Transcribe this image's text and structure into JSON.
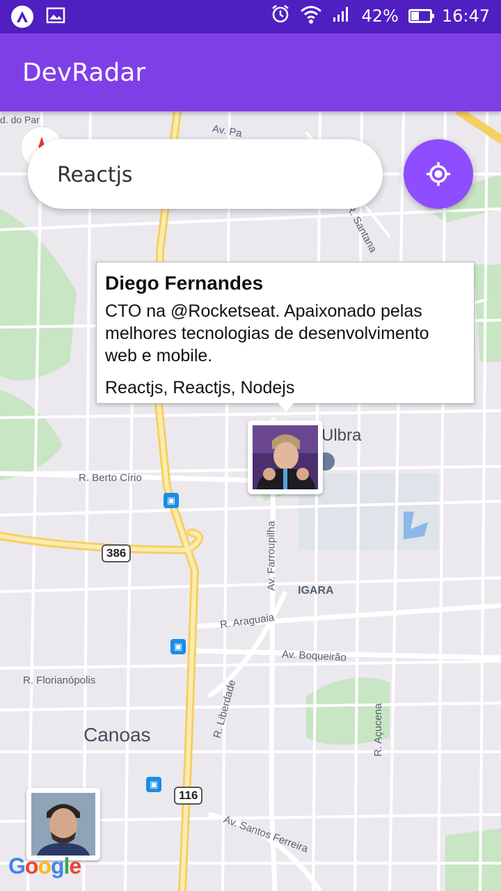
{
  "status_bar": {
    "battery": "42%",
    "time": "16:47",
    "battery_level": 0.42
  },
  "app_bar": {
    "title": "DevRadar"
  },
  "search": {
    "value": "Reactjs"
  },
  "callout": {
    "name": "Diego Fernandes",
    "bio": "CTO na @Rocketseat. Apaixonado pelas melhores tecnologias de desenvolvimento web e mobile.",
    "techs": "Reactjs, Reactjs, Nodejs"
  },
  "map_labels": {
    "ulbra": "Ulbra",
    "berto_cirio": "R. Berto Círio",
    "farroupilha": "Av. Farroupilha",
    "igara": "IGARA",
    "araguaia": "R. Araguaia",
    "boqueirao": "Av. Boqueirão",
    "florianopolis": "R. Florianópolis",
    "liberdade": "R. Liberdade",
    "acucena": "R. Açucena",
    "canoas": "Canoas",
    "santos_ferreira": "Av. Santos Ferreira",
    "santana": "R. Santana",
    "av_pa": "Av. Pa",
    "do_par": "d. do Par",
    "route_386": "386",
    "route_116": "116"
  },
  "google_logo": "Google",
  "colors": {
    "status_bar": "#4f1fc1",
    "app_bar": "#7d40e7",
    "locate_button": "#8e4dff"
  }
}
